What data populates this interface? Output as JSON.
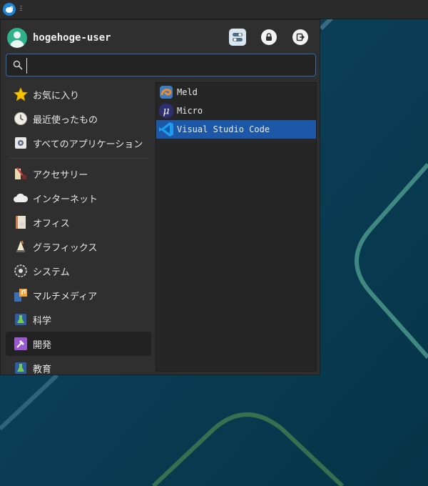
{
  "user": {
    "name": "hogehoge-user"
  },
  "search": {
    "value": "",
    "placeholder": ""
  },
  "categories": [
    {
      "label": "お気に入り",
      "icon": "star-icon"
    },
    {
      "label": "最近使ったもの",
      "icon": "clock-icon"
    },
    {
      "label": "すべてのアプリケーション",
      "icon": "all-apps-icon"
    },
    {
      "label": "アクセサリー",
      "icon": "accessories-icon"
    },
    {
      "label": "インターネット",
      "icon": "cloud-icon"
    },
    {
      "label": "オフィス",
      "icon": "office-icon"
    },
    {
      "label": "グラフィックス",
      "icon": "graphics-icon"
    },
    {
      "label": "システム",
      "icon": "system-gear-icon"
    },
    {
      "label": "マルチメディア",
      "icon": "multimedia-icon"
    },
    {
      "label": "科学",
      "icon": "science-flask-icon"
    },
    {
      "label": "開発",
      "icon": "development-hammer-icon"
    },
    {
      "label": "教育",
      "icon": "education-flask-icon"
    }
  ],
  "selected_category": "開発",
  "apps": [
    {
      "label": "Meld",
      "icon": "meld-icon"
    },
    {
      "label": "Micro",
      "icon": "micro-mu-icon",
      "glyph": "μ"
    },
    {
      "label": "Visual Studio Code",
      "icon": "vscode-icon"
    }
  ],
  "selected_app": "Visual Studio Code",
  "colors": {
    "accent": "#1d58a8",
    "search_border": "#2f6ab3",
    "avatar": "#2fb28c",
    "menu_bg": "#2f2f2f",
    "desktop_bg": "#0b3f57"
  }
}
